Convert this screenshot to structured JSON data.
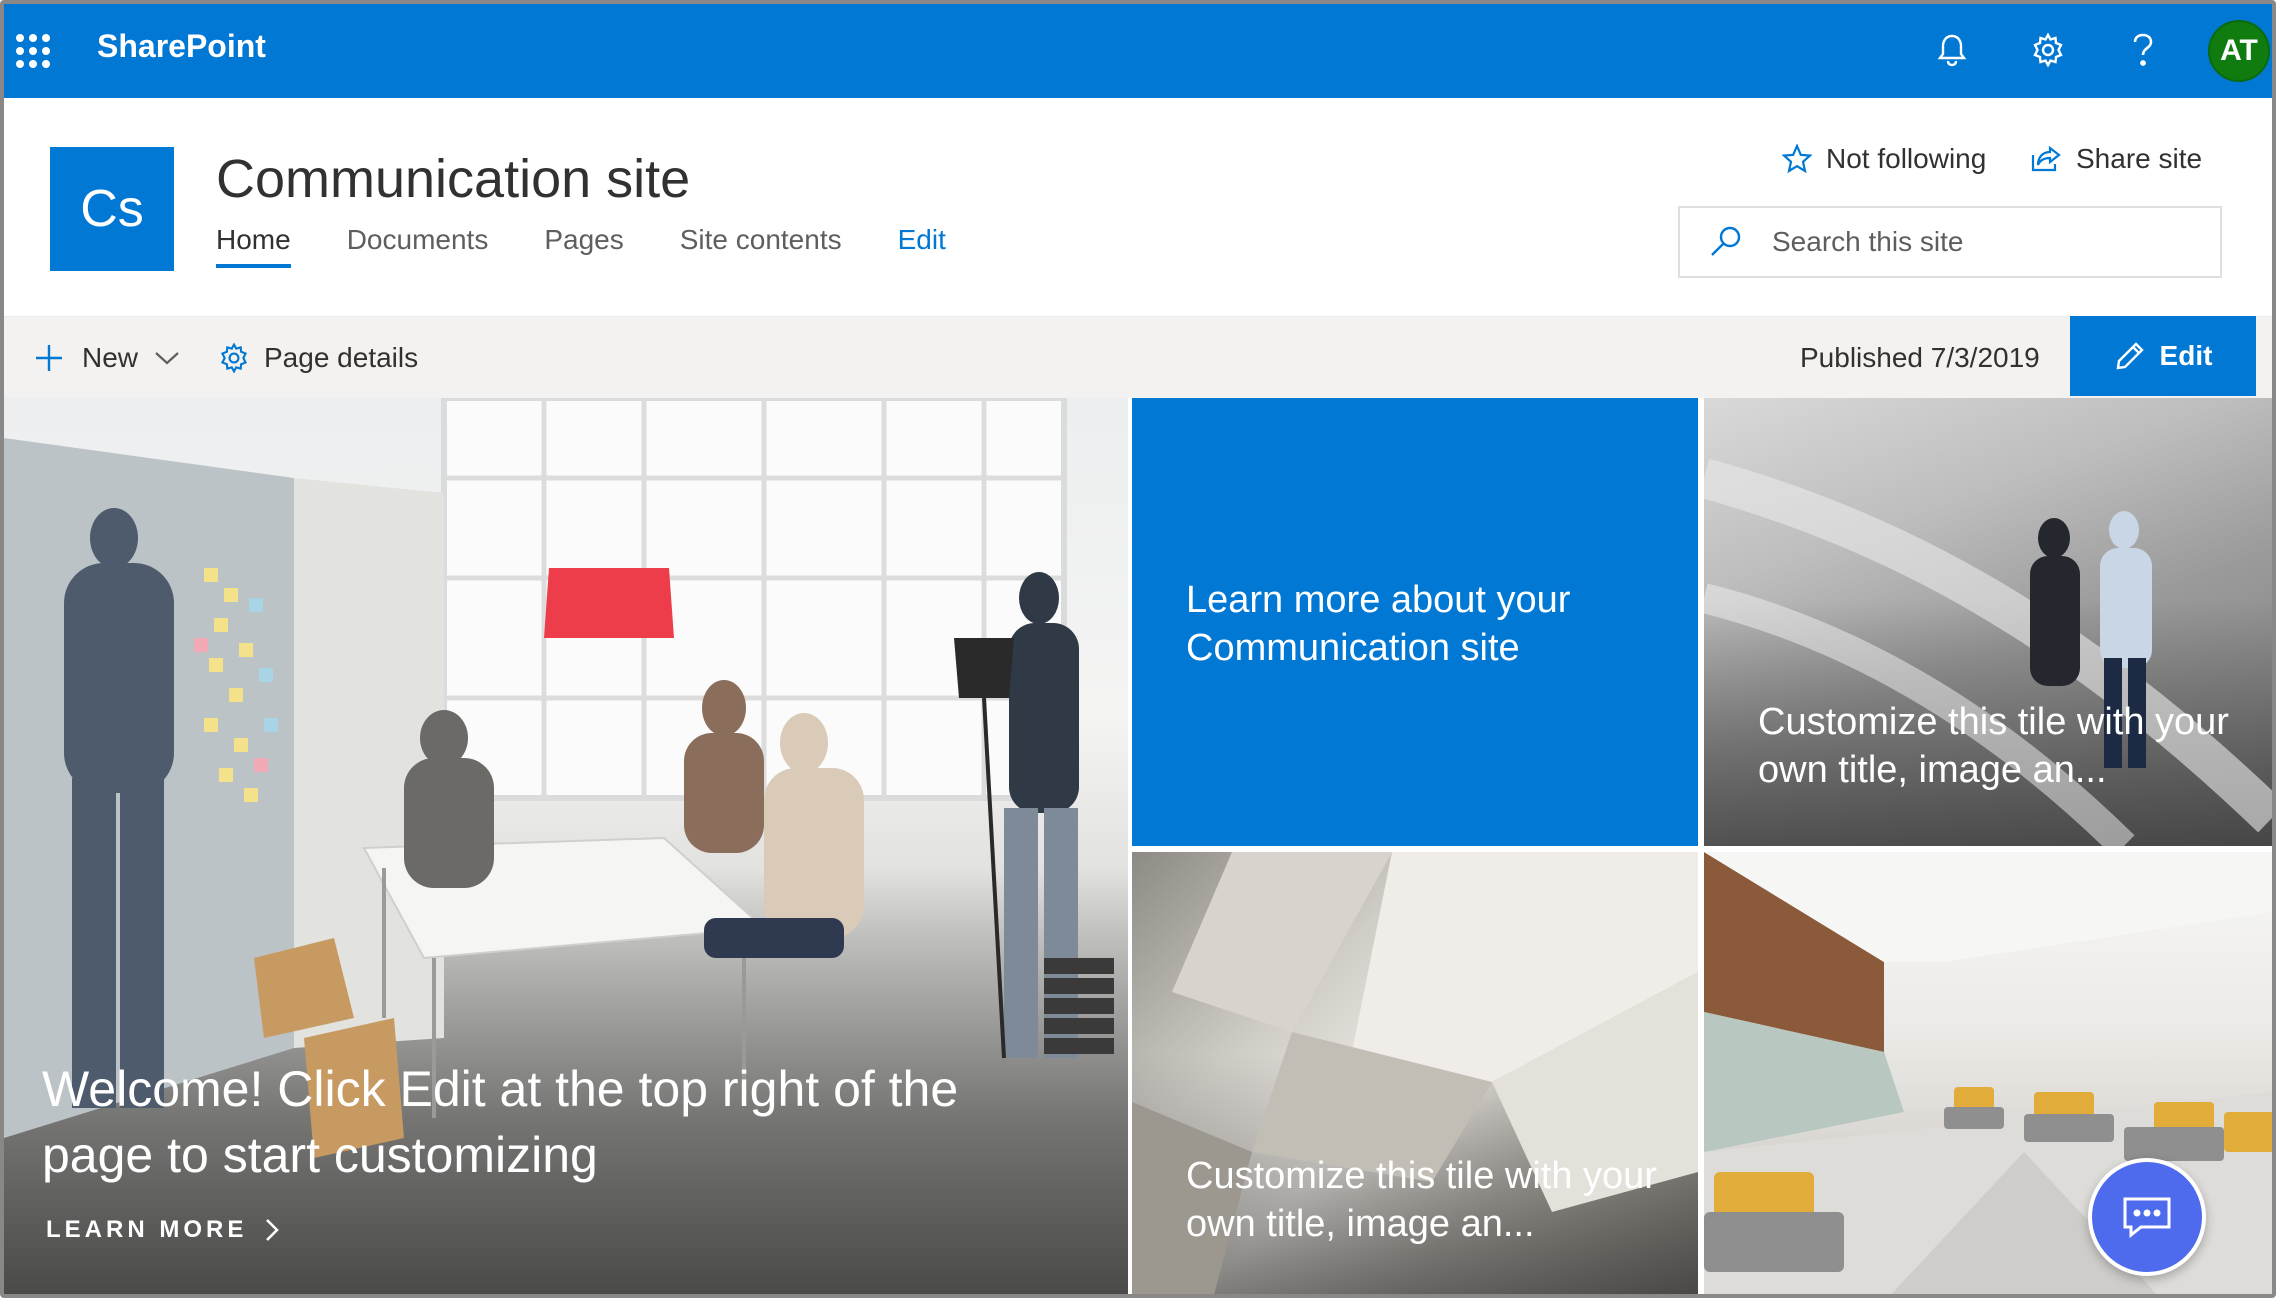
{
  "suite_bar": {
    "brand": "SharePoint",
    "avatar_initials": "AT",
    "icons": [
      "app-launcher-icon",
      "bell-icon",
      "gear-icon",
      "help-icon"
    ],
    "color": "#0078d4",
    "avatar_color": "#107c10"
  },
  "site": {
    "logo_initials": "Cs",
    "title": "Communication site",
    "nav": [
      {
        "label": "Home",
        "active": true
      },
      {
        "label": "Documents",
        "active": false
      },
      {
        "label": "Pages",
        "active": false
      },
      {
        "label": "Site contents",
        "active": false
      },
      {
        "label": "Edit",
        "active": false
      }
    ],
    "follow_label": "Not following",
    "share_label": "Share site",
    "search_placeholder": "Search this site"
  },
  "command_bar": {
    "new_label": "New",
    "page_details_label": "Page details",
    "published_text": "Published 7/3/2019",
    "edit_label": "Edit"
  },
  "hero": {
    "main": {
      "caption": "Welcome! Click Edit at the top right of the page to start customizing",
      "link_label": "LEARN MORE"
    },
    "tiles": [
      {
        "caption": "Learn more about your Communication site"
      },
      {
        "caption": "Customize this tile with your own title, image an..."
      },
      {
        "caption": "Customize this tile with your own title, image an..."
      }
    ]
  },
  "colors": {
    "accent": "#0078d4",
    "chat_button": "#4f6bed"
  }
}
